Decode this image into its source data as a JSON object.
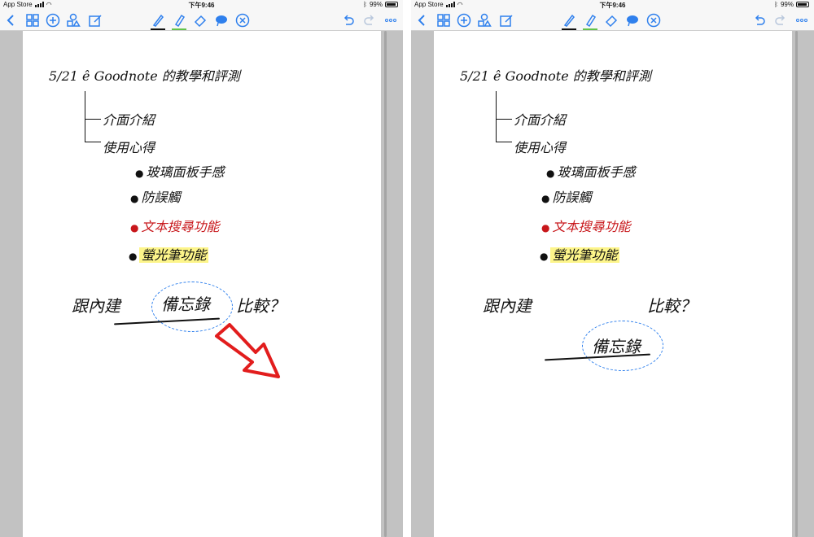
{
  "status_bar": {
    "carrier": "App Store",
    "time": "下午9:46",
    "battery": "99%"
  },
  "toolbar": {
    "icons": [
      "back-icon",
      "thumbnails-icon",
      "add-icon",
      "shapes-icon",
      "edit-icon",
      "pen-icon",
      "highlighter-icon",
      "eraser-icon",
      "lasso-icon",
      "close-icon",
      "undo-icon",
      "redo-icon",
      "more-icon"
    ]
  },
  "note": {
    "title": "5/21 ê Goodnote 的教學和評測",
    "branch1": "介面介紹",
    "branch2": "使用心得",
    "item1": "玻璃面板手感",
    "item2": "防誤觸",
    "item3": "文本搜尋功能",
    "item4": "螢光筆功能",
    "compare_prefix": "跟內建",
    "compare_word": "備忘錄",
    "compare_suffix": "比較？"
  },
  "colors": {
    "accent": "#2f80ed",
    "ink": "#111111",
    "red_ink": "#c8171b",
    "highlight": "#fdf58a",
    "arrow": "#e21d1d"
  }
}
